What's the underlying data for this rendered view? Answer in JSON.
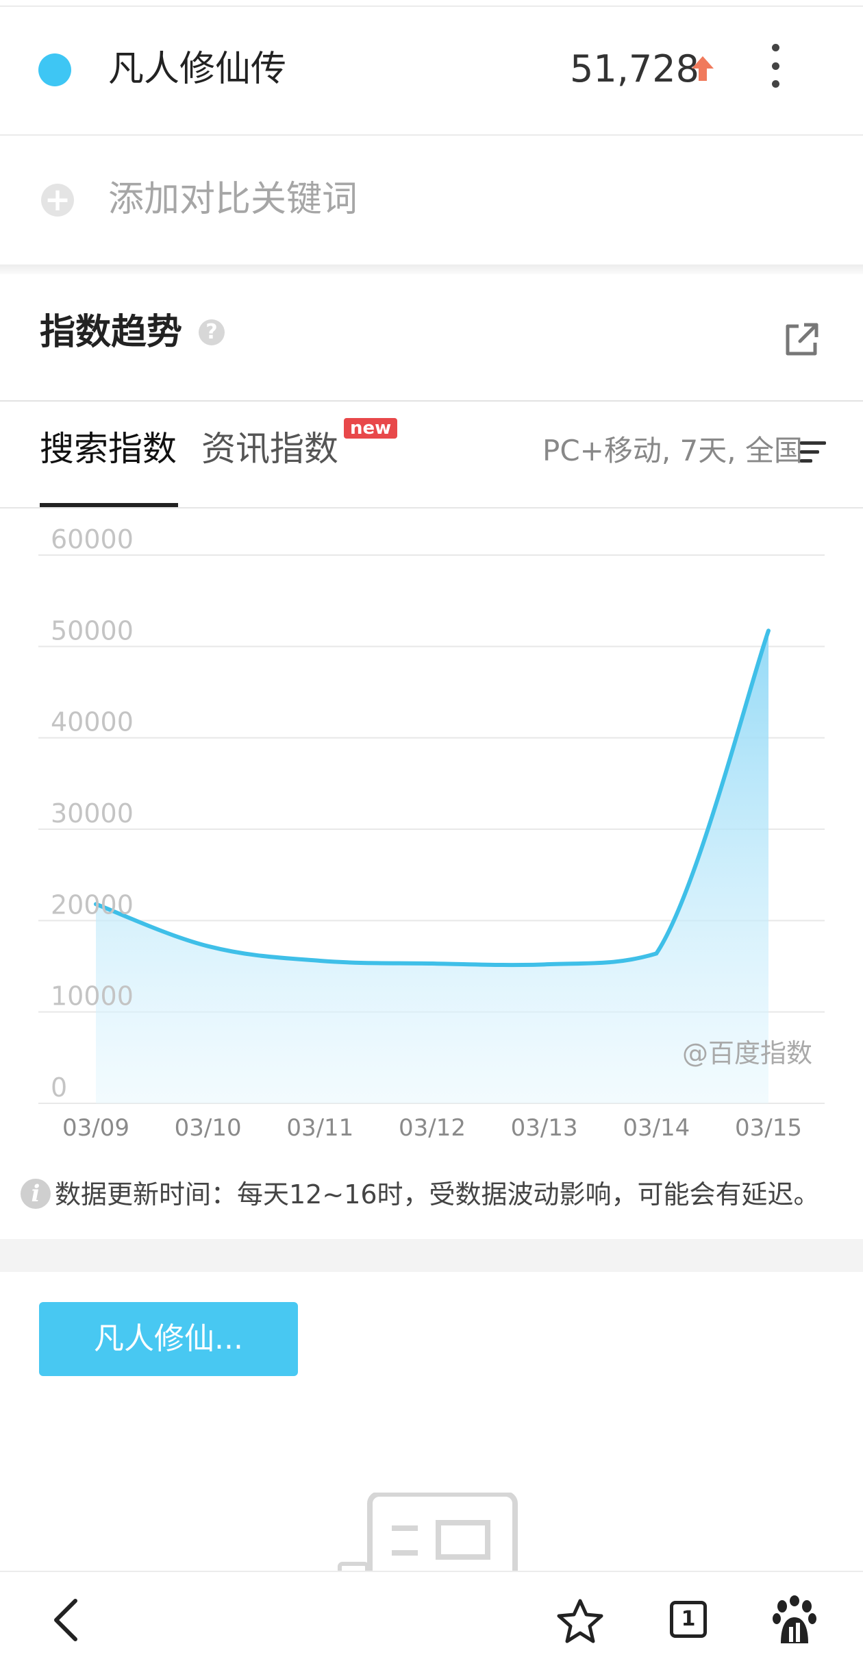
{
  "keyword": {
    "name": "凡人修仙传",
    "value": "51,728",
    "dot_color": "#3ec6f4",
    "trend_arrow": "up-arrow",
    "arrow_color": "#f07a5c"
  },
  "compare": {
    "add_label": "添加对比关键词"
  },
  "section": {
    "title": "指数趋势",
    "help_icon": "question-icon",
    "share_icon": "share-external-icon"
  },
  "tabs": [
    {
      "label": "搜索指数",
      "active": true
    },
    {
      "label": "资讯指数",
      "badge": "new"
    }
  ],
  "filter": {
    "label": "PC+移动, 7天, 全国",
    "icon": "filter-lines-icon"
  },
  "chart_data": {
    "type": "area",
    "x": [
      "03/09",
      "03/10",
      "03/11",
      "03/12",
      "03/13",
      "03/14",
      "03/15"
    ],
    "series": [
      {
        "values": [
          21800,
          17200,
          15600,
          15300,
          15200,
          16400,
          51728
        ]
      }
    ],
    "ylim": [
      0,
      60000
    ],
    "yticks": [
      "0",
      "10000",
      "20000",
      "30000",
      "40000",
      "50000",
      "60000"
    ],
    "grid": true,
    "watermark": "@百度指数",
    "line_color": "#3fbfe8",
    "fill_color": "#9edcf7"
  },
  "note": {
    "icon": "info-icon",
    "text": "数据更新时间：每天12~16时，受数据波动影响，可能会有延迟。"
  },
  "keyword_button": {
    "label": "凡人修仙..."
  },
  "bottom_nav": {
    "back_icon": "back-icon",
    "favorite_icon": "star-icon",
    "tabs_count": "1",
    "tabs_icon": "tabs-icon",
    "app_icon": "baidu-paw-icon"
  }
}
